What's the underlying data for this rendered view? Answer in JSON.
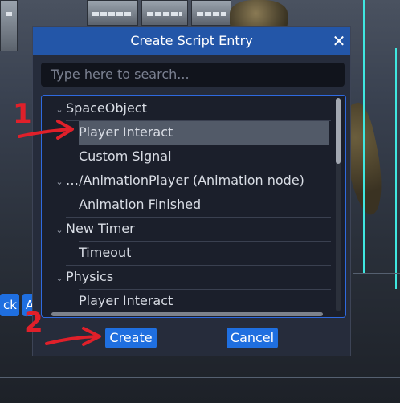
{
  "dialog": {
    "title": "Create Script Entry",
    "close_icon": "close-icon",
    "search_placeholder": "Type here to search...",
    "tree": [
      {
        "label": "SpaceObject",
        "type": "group",
        "expanded": true
      },
      {
        "label": "Player Interact",
        "type": "item",
        "selected": true
      },
      {
        "label": "Custom Signal",
        "type": "item"
      },
      {
        "label": "…/AnimationPlayer  (Animation node)",
        "type": "group",
        "expanded": true
      },
      {
        "label": "Animation Finished",
        "type": "item"
      },
      {
        "label": "New Timer",
        "type": "group",
        "expanded": true
      },
      {
        "label": "Timeout",
        "type": "item"
      },
      {
        "label": "Physics",
        "type": "group",
        "expanded": true
      },
      {
        "label": "Player Interact",
        "type": "item"
      }
    ],
    "create_label": "Create",
    "cancel_label": "Cancel"
  },
  "background": {
    "side_button_1": "ck",
    "side_button_2": "A"
  },
  "annotations": {
    "step1": "1",
    "step2": "2",
    "color": "#e0202a"
  },
  "colors": {
    "titlebar": "#2356a8",
    "button": "#1f6fe0",
    "tree_border": "#2f6ae0",
    "selection": "#525a68"
  }
}
